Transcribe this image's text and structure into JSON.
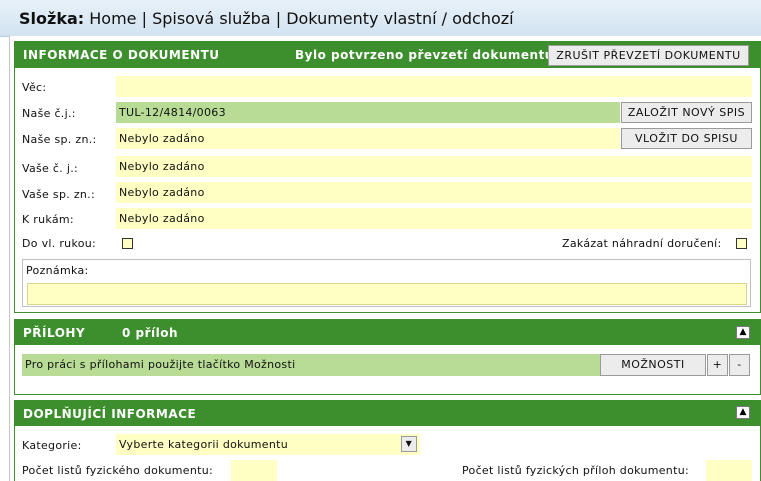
{
  "breadcrumb": {
    "prefix": "Složka:",
    "home": "Home",
    "sep1": "|",
    "spisova": "Spisová služba",
    "sep2": "|",
    "current": "Dokumenty vlastní / odchozí"
  },
  "info_section": {
    "title": "INFORMACE O DOKUMENTU",
    "status": "Bylo potvrzeno převzetí dokumentu",
    "cancel_button": "ZRUŠIT PŘEVZETÍ DOKUMENTU",
    "vec_label": "Věc:",
    "vec_value": "",
    "nase_cj_label": "Naše č.j.:",
    "nase_cj_value": "TUL-12/4814/0063",
    "new_spis_button": "ZALOŽIT NOVÝ SPIS",
    "nase_spzn_label": "Naše sp. zn.:",
    "nase_spzn_value": "Nebylo zadáno",
    "vlozit_button": "VLOŽIT DO SPISU",
    "vase_cj_label": "Vaše č. j.:",
    "vase_cj_value": "Nebylo zadáno",
    "vase_spzn_label": "Vaše sp. zn.:",
    "vase_spzn_value": "Nebylo zadáno",
    "krukam_label": "K rukám:",
    "krukam_value": "Nebylo zadáno",
    "dovl_label": "Do vl. rukou:",
    "zakazat_label": "Zakázat náhradní doručení:",
    "poznamka_label": "Poznámka:",
    "poznamka_value": ""
  },
  "prilohy_section": {
    "title": "PŘÍLOHY",
    "count": "0 příloh",
    "collapse_icon": "▲",
    "hint": "Pro práci s přílohami použijte tlačítko Možnosti",
    "moznosti_button": "MOŽNOSTI",
    "plus_button": "+",
    "minus_button": "-"
  },
  "doplnujici_section": {
    "title": "DOPLŇUJÍCÍ INFORMACE",
    "collapse_icon": "▲",
    "kategorie_label": "Kategorie:",
    "kategorie_value": "Vyberte kategorii dokumentu",
    "dropdown_icon": "▼",
    "pocet_listu_label": "Počet listů fyzického dokumentu:",
    "pocet_listu_value": "",
    "pocet_priloh_label": "Počet listů fyzických příloh dokumentu:",
    "pocet_priloh_value": ""
  }
}
